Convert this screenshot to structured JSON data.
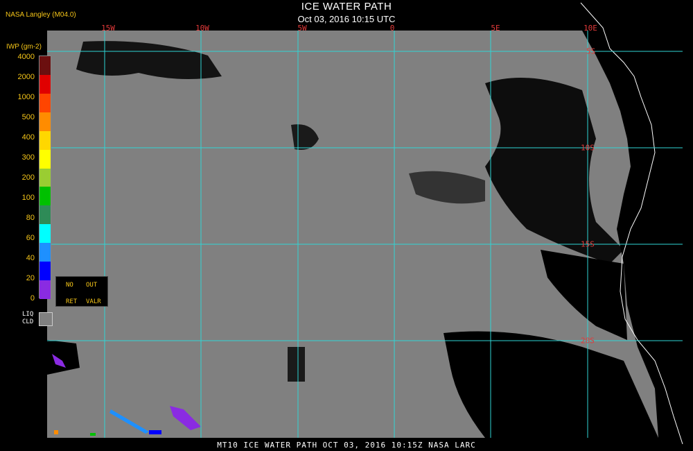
{
  "header": {
    "title": "ICE WATER PATH",
    "subtitle": "Oct 03, 2016 10:15 UTC",
    "credit": "NASA Langley (M04.0)"
  },
  "map": {
    "lon_labels": [
      "15W",
      "10W",
      "5W",
      "0",
      "5E",
      "10E"
    ],
    "lat_labels": [
      "5S",
      "10S",
      "15S",
      "20S"
    ],
    "grid_color": "#2fd6d6",
    "ocean_cloud_color": "#808080",
    "clear_color": "#000000",
    "coast_color": "#ffffff",
    "label_color": "#e23a3a"
  },
  "legend": {
    "unit_label": "IWP (gm-2)",
    "ticks": [
      "4000",
      "2000",
      "1000",
      "500",
      "400",
      "300",
      "200",
      "100",
      "80",
      "60",
      "40",
      "20",
      "0"
    ],
    "colors": [
      "#6b0f0f",
      "#e00000",
      "#ff4500",
      "#ff8c00",
      "#ffd700",
      "#ffff00",
      "#9acd32",
      "#00c000",
      "#2e8b57",
      "#00ffff",
      "#1e90ff",
      "#0000ff",
      "#8a2be2"
    ],
    "no_ret": [
      "NO",
      "RET"
    ],
    "out_valr": [
      "OUT",
      "VALR"
    ],
    "liq_cld": [
      "LIQ",
      "CLD"
    ]
  },
  "footer": "MT10  ICE WATER PATH  OCT 03, 2016 10:15Z  NASA LARC"
}
